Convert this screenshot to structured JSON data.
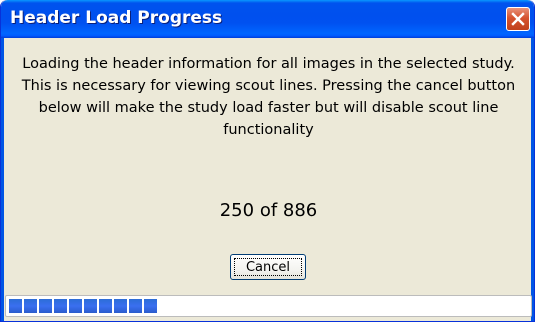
{
  "window": {
    "title": "Header Load Progress"
  },
  "message": "Loading the header information for all images in the selected study. This is necessary for viewing scout lines. Pressing the cancel button below will make the study load faster but will disable scout line functionality",
  "progress": {
    "current": 250,
    "total": 886,
    "text": "250 of 886",
    "fraction": 0.28
  },
  "buttons": {
    "cancel_label": "Cancel"
  },
  "icons": {
    "close": "close-icon"
  },
  "colors": {
    "titlebar": "#0054e3",
    "close_button": "#d6532f",
    "dialog_background": "#ece9d8",
    "progress_block": "#3167e8"
  }
}
